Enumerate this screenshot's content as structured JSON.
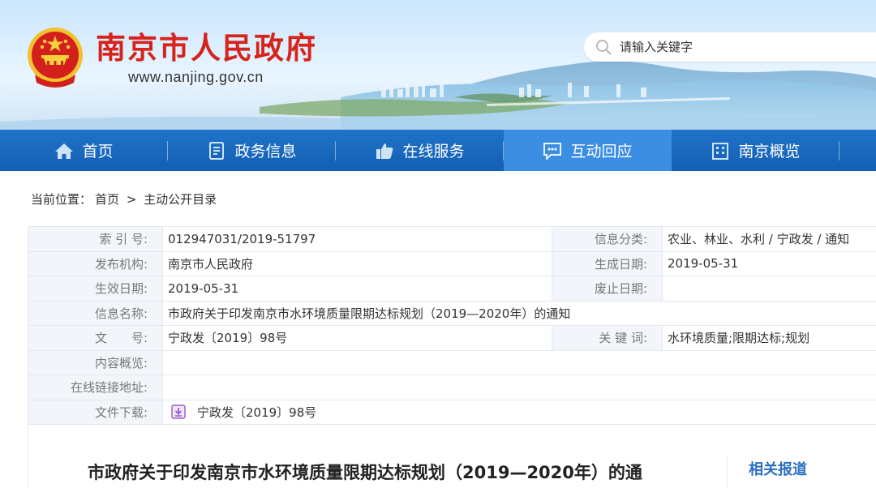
{
  "header": {
    "site_title": "南京市人民政府",
    "site_url": "www.nanjing.gov.cn",
    "emblem_icon": "national-emblem-icon"
  },
  "search": {
    "placeholder": "请输入关键字",
    "icon": "search-icon"
  },
  "nav": {
    "items": [
      {
        "label": "首页",
        "icon": "home-icon",
        "active": false
      },
      {
        "label": "政务信息",
        "icon": "document-icon",
        "active": false
      },
      {
        "label": "在线服务",
        "icon": "thumbs-up-icon",
        "active": false
      },
      {
        "label": "互动回应",
        "icon": "chat-icon",
        "active": true
      },
      {
        "label": "南京概览",
        "icon": "building-icon",
        "active": false
      }
    ]
  },
  "breadcrumb": {
    "prefix": "当前位置：",
    "home": "首页",
    "separator": ">",
    "current": "主动公开目录"
  },
  "info": {
    "index_label": "索 引 号:",
    "index_value": "012947031/2019-51797",
    "category_label": "信息分类:",
    "category_value": "农业、林业、水利 / 宁政发 / 通知",
    "publisher_label": "发布机构:",
    "publisher_value": "南京市人民政府",
    "created_label": "生成日期:",
    "created_value": "2019-05-31",
    "effective_label": "生效日期:",
    "effective_value": "2019-05-31",
    "expired_label": "废止日期:",
    "expired_value": "",
    "name_label": "信息名称:",
    "name_value": "市政府关于印发南京市水环境质量限期达标规划（2019—2020年）的通知",
    "docno_label": "文　　号:",
    "docno_value": "宁政发〔2019〕98号",
    "keywords_label": "关 键 词:",
    "keywords_value": "水环境质量;限期达标;规划",
    "summary_label": "内容概览:",
    "summary_value": "",
    "link_label": "在线链接地址:",
    "link_value": "",
    "download_label": "文件下载:",
    "download_value": "宁政发〔2019〕98号",
    "download_icon": "download-icon"
  },
  "article": {
    "title": "市政府关于印发南京市水环境质量限期达标规划（2019—2020年）的通"
  },
  "sidebar": {
    "title": "相关报道"
  },
  "colors": {
    "nav_bg": "#135fb4",
    "nav_active": "#3c8ee3",
    "title_red": "#d7231b",
    "label_bg": "#f2f6fa",
    "sidebar_blue": "#2a6fc0"
  }
}
